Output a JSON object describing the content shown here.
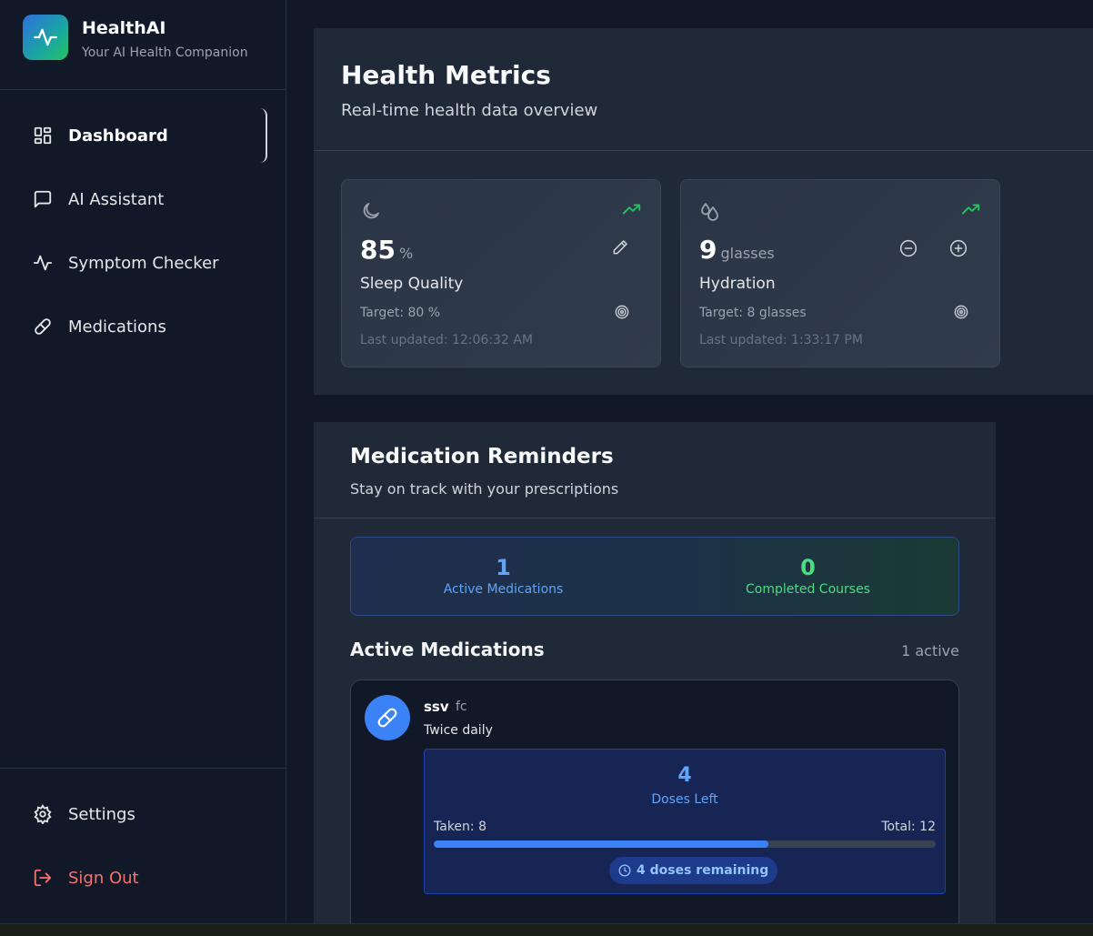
{
  "brand": {
    "name": "HealthAI",
    "tagline": "Your AI Health Companion"
  },
  "nav": {
    "items": [
      {
        "label": "Dashboard",
        "icon": "grid-icon",
        "active": true
      },
      {
        "label": "AI Assistant",
        "icon": "chat-icon"
      },
      {
        "label": "Symptom Checker",
        "icon": "activity-icon"
      },
      {
        "label": "Medications",
        "icon": "pill-icon"
      }
    ],
    "settings": "Settings",
    "sign_out": "Sign Out"
  },
  "metrics": {
    "title": "Health Metrics",
    "subtitle": "Real-time health data overview",
    "cards": [
      {
        "value": "85",
        "unit": "%",
        "label": "Sleep Quality",
        "target": "Target: 80 %",
        "updated": "Last updated: 12:06:32 AM"
      },
      {
        "value": "9",
        "unit": "glasses",
        "label": "Hydration",
        "target": "Target: 8 glasses",
        "updated": "Last updated: 1:33:17 PM"
      }
    ]
  },
  "medications": {
    "title": "Medication Reminders",
    "subtitle": "Stay on track with your prescriptions",
    "stats": {
      "active": {
        "value": "1",
        "label": "Active Medications"
      },
      "completed": {
        "value": "0",
        "label": "Completed Courses"
      }
    },
    "active_title": "Active Medications",
    "active_count": "1 active",
    "items": [
      {
        "name": "ssv",
        "dose": "fc",
        "frequency": "Twice daily",
        "doses_left": "4",
        "doses_left_label": "Doses Left",
        "taken": "Taken: 8",
        "total": "Total: 12",
        "progress": 0.6667,
        "remaining": "4 doses remaining"
      }
    ]
  },
  "colors": {
    "accent": "#3b82f6",
    "success": "#4ade80",
    "danger": "#f87171",
    "panel": "#1f2937",
    "background": "#111827"
  }
}
